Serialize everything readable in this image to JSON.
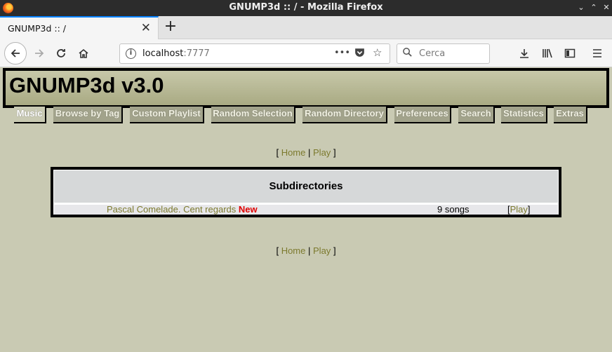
{
  "window": {
    "title": "GNUMP3d :: / - Mozilla Firefox",
    "controls": [
      "⌄",
      "⌃",
      "✕"
    ]
  },
  "tab": {
    "title": "GNUMP3d :: /",
    "close": "✕",
    "new_tab": "+"
  },
  "nav": {
    "url_host": "localhost",
    "url_port": ":7777",
    "search_placeholder": "Cerca",
    "page_actions": "•••"
  },
  "page": {
    "heading": "GNUMP3d v3.0",
    "tabs": [
      "Music",
      "Browse by Tag",
      "Custom Playlist",
      "Random Selection",
      "Random Directory",
      "Preferences",
      "Search",
      "Statistics",
      "Extras"
    ],
    "links": {
      "home": "Home",
      "play": "Play",
      "open": "[",
      "sep": "|",
      "close": "]"
    },
    "subdirectories": {
      "header": "Subdirectories",
      "rows": [
        {
          "title": "Pascal Comelade. Cent regards",
          "badge": "New",
          "count": "9 songs",
          "play": "Play"
        }
      ]
    }
  }
}
